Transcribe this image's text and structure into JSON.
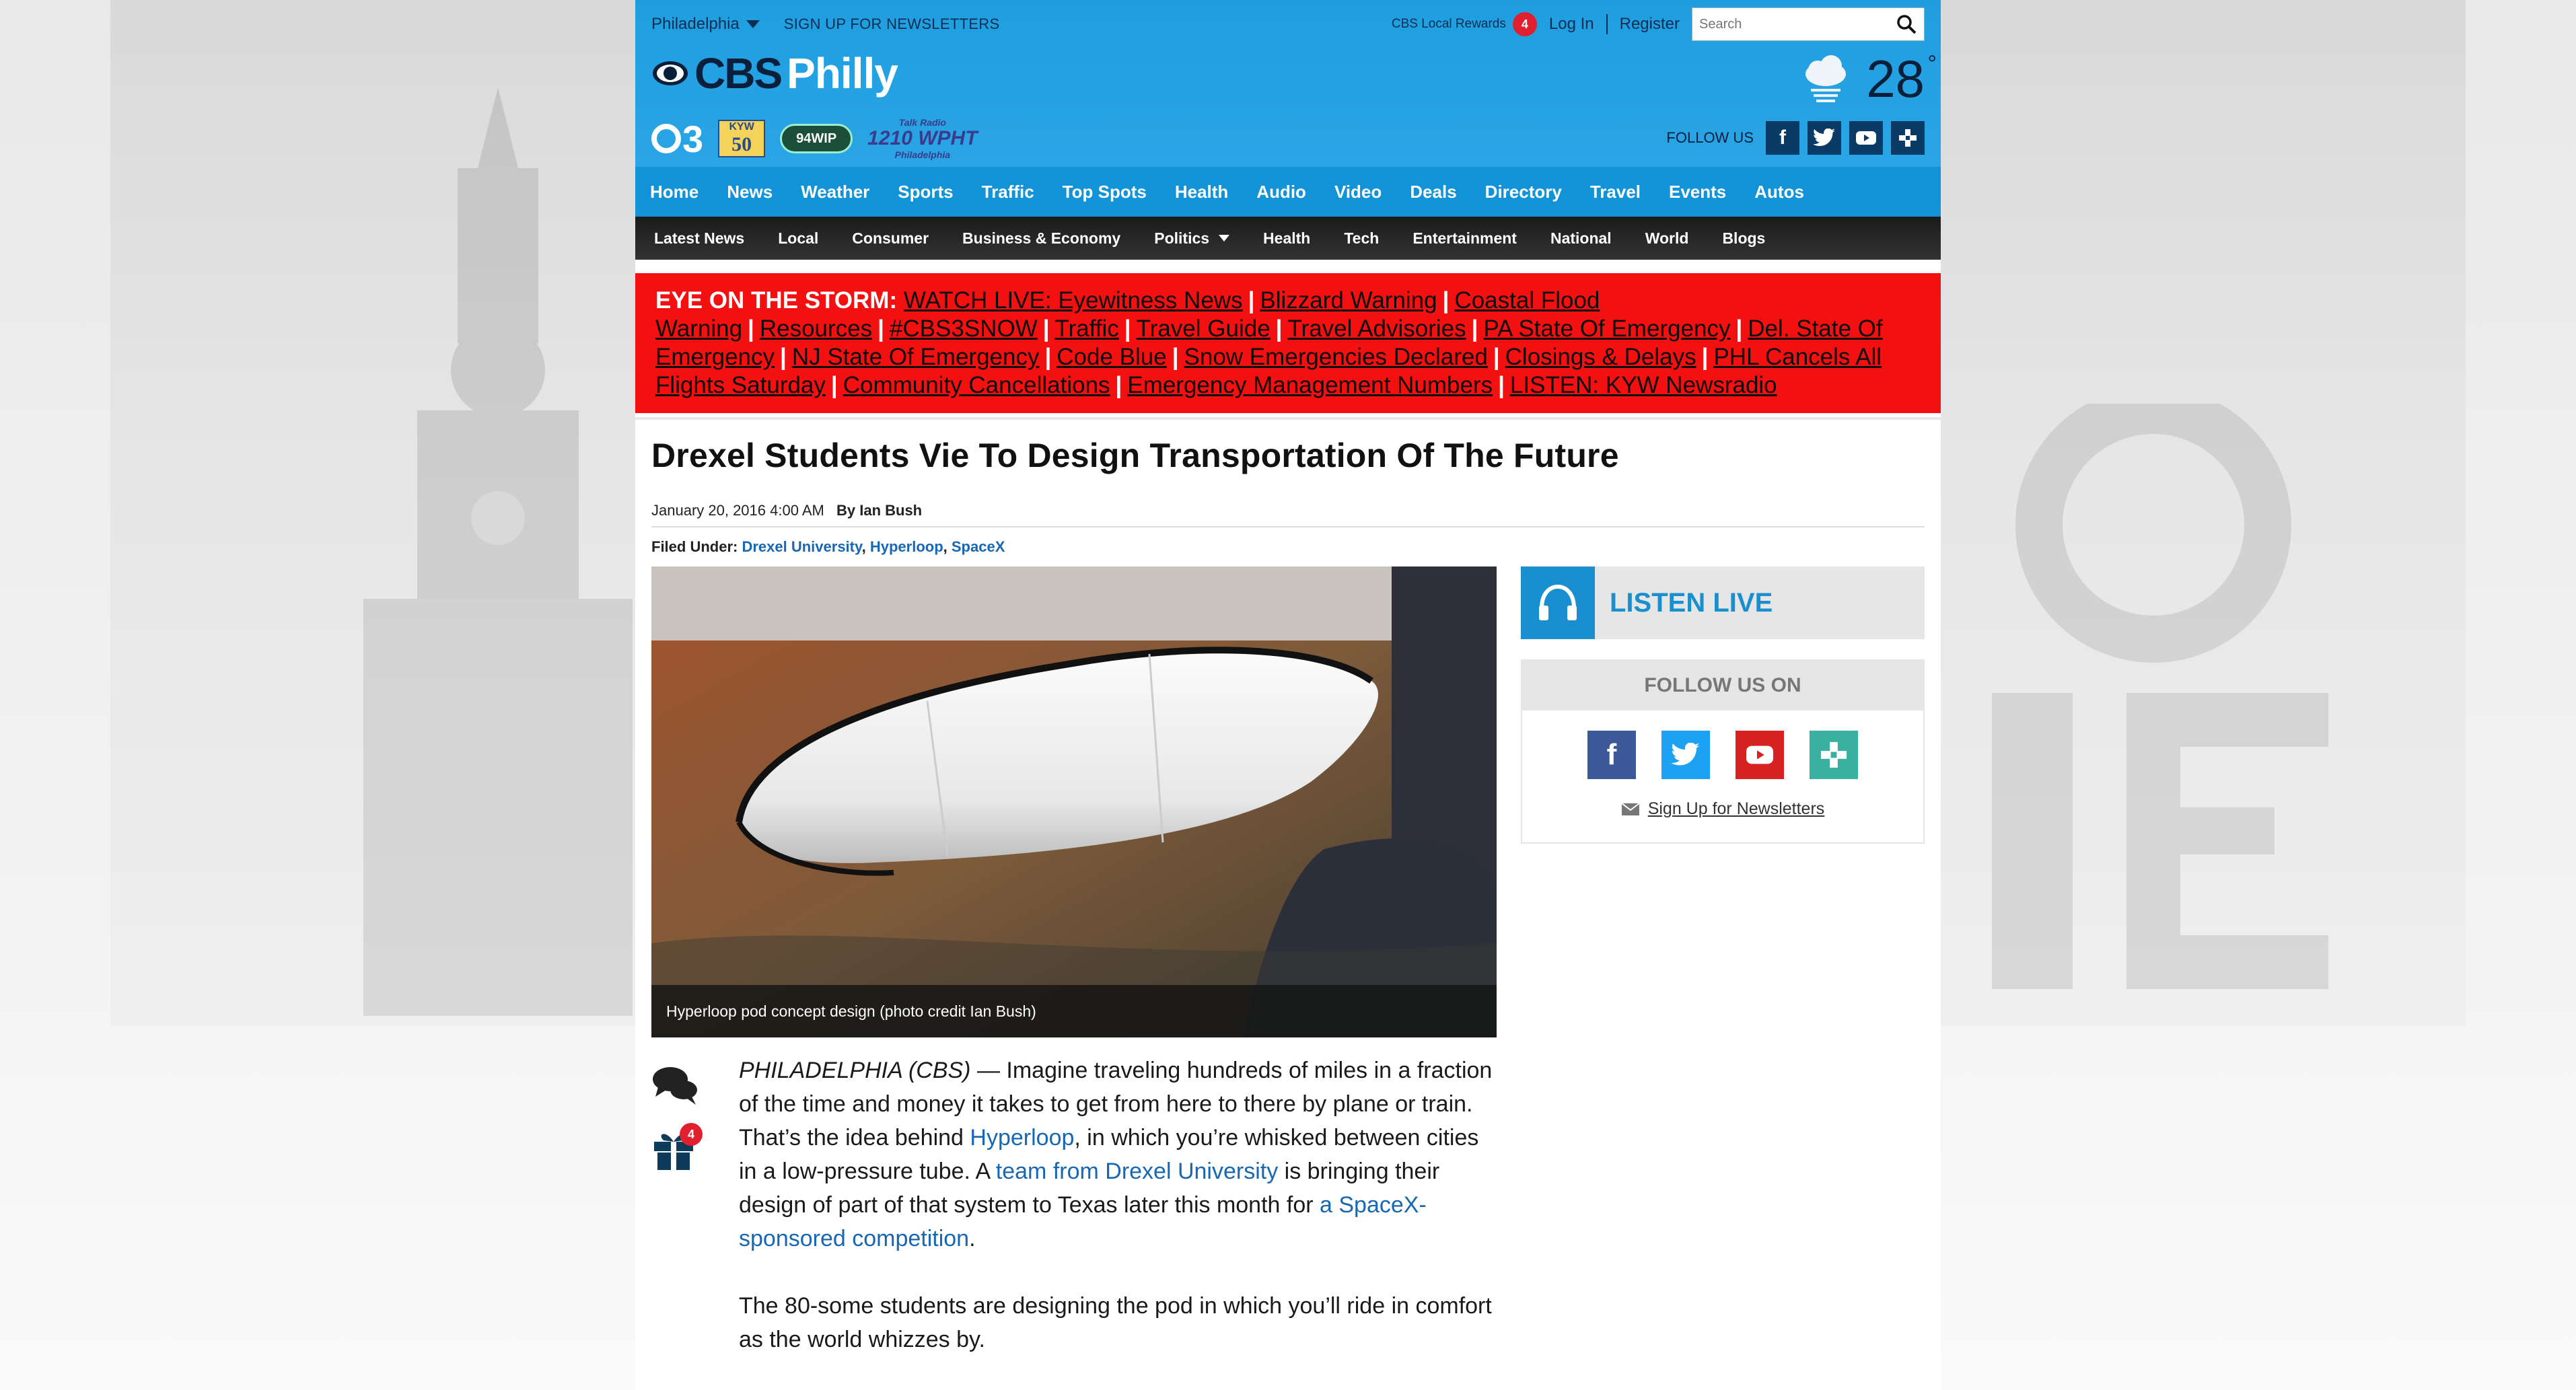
{
  "topbar": {
    "city": "Philadelphia",
    "newsletter": "SIGN UP FOR NEWSLETTERS",
    "rewards": "CBS Local Rewards",
    "rewards_count": "4",
    "login": "Log In",
    "register": "Register",
    "search_placeholder": "Search"
  },
  "logo": {
    "cbs": "CBS",
    "philly": "Philly"
  },
  "stations": {
    "c3": "C3",
    "kyw_top": "KYW",
    "kyw_num": "50",
    "wip": "94WIP",
    "wpht_top": "Talk Radio",
    "wpht": "1210 WPHT",
    "wpht_city": "Philadelphia"
  },
  "weather": {
    "temp": "28",
    "degree": "°"
  },
  "follow_top": {
    "label": "FOLLOW US"
  },
  "nav_primary": [
    "Home",
    "News",
    "Weather",
    "Sports",
    "Traffic",
    "Top Spots",
    "Health",
    "Audio",
    "Video",
    "Deals",
    "Directory",
    "Travel",
    "Events",
    "Autos"
  ],
  "nav_secondary": [
    "Latest News",
    "Local",
    "Consumer",
    "Business & Economy",
    "Politics",
    "Health",
    "Tech",
    "Entertainment",
    "National",
    "World",
    "Blogs"
  ],
  "alert": {
    "heading": "EYE ON THE STORM:",
    "links": [
      "WATCH LIVE: Eyewitness News",
      "Blizzard Warning",
      "Coastal Flood Warning",
      "Resources",
      "#CBS3SNOW",
      "Traffic",
      "Travel Guide",
      "Travel Advisories",
      "PA State Of Emergency",
      "Del. State Of Emergency",
      "NJ State Of Emergency",
      "Code Blue",
      "Snow Emergencies Declared",
      "Closings & Delays",
      "PHL Cancels All Flights Saturday",
      "Community Cancellations",
      "Emergency Management Numbers",
      "LISTEN: KYW Newsradio"
    ]
  },
  "article": {
    "title": "Drexel Students Vie To Design Transportation Of The Future",
    "date": "January 20, 2016 4:00 AM",
    "byline": "By Ian Bush",
    "filed_label": "Filed Under:",
    "tags": [
      "Drexel University",
      "Hyperloop",
      "SpaceX"
    ],
    "caption": "Hyperloop pod concept design (photo credit Ian Bush)",
    "gift_count": "4",
    "p1_dateline": "PHILADELPHIA (CBS)",
    "p1_a": " — Imagine traveling hundreds of miles in a fraction of the time and money it takes to get from here to there by plane or train. That’s the idea behind ",
    "p1_link1": "Hyperloop",
    "p1_b": ", in which you’re whisked between cities in a low-pressure tube. A ",
    "p1_link2": "team from Drexel University",
    "p1_c": " is bringing their design of part of that system to Texas later this month for ",
    "p1_link3": "a SpaceX-sponsored competition",
    "p1_d": ".",
    "p2": "The 80-some students are designing the pod in which you’ll ride in comfort as the world whizzes by."
  },
  "sidebar": {
    "listen": "LISTEN LIVE",
    "follow_heading": "FOLLOW US ON",
    "newsletter": "Sign Up for Newsletters"
  },
  "colors": {
    "brand_blue": "#1e9ee0",
    "alert_red": "#f21010",
    "link_blue": "#1767b3"
  }
}
